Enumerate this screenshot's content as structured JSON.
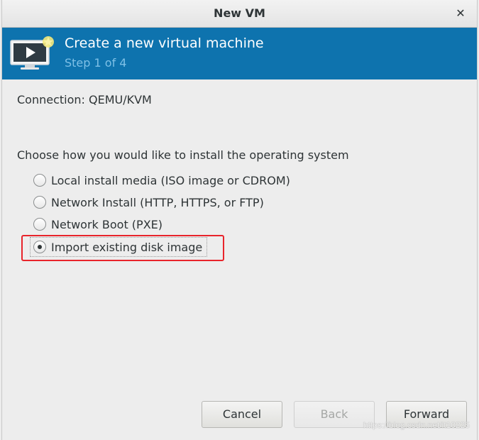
{
  "window": {
    "title": "New VM"
  },
  "banner": {
    "title": "Create a new virtual machine",
    "step": "Step 1 of 4",
    "accent_color": "#0e73ae",
    "icon": "monitor-play-icon"
  },
  "connection": {
    "text": "Connection:  QEMU/KVM"
  },
  "install": {
    "prompt": "Choose how you would like to install the operating system",
    "options": [
      {
        "label": "Local install media (ISO image or CDROM)",
        "checked": false
      },
      {
        "label": "Network Install (HTTP, HTTPS, or FTP)",
        "checked": false
      },
      {
        "label": "Network Boot (PXE)",
        "checked": false
      },
      {
        "label": "Import existing disk image",
        "checked": true
      }
    ]
  },
  "buttons": {
    "cancel": "Cancel",
    "back": "Back",
    "forward": "Forward"
  },
  "watermark": "https://blog.csdn.net/lt10225",
  "annotation_color": "#e8242b"
}
